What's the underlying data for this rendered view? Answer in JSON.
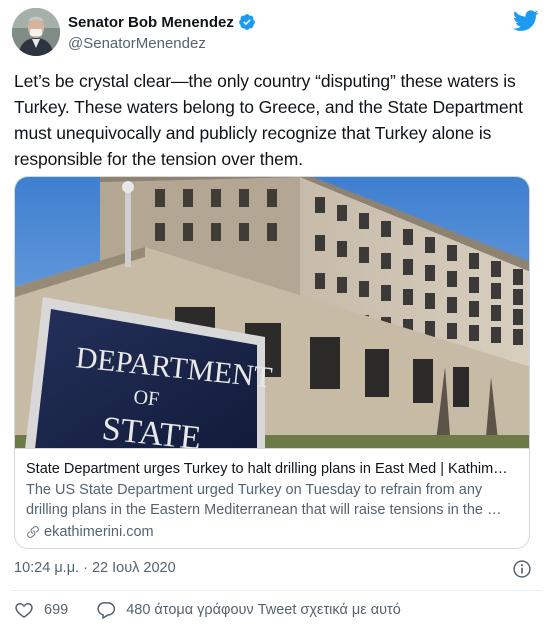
{
  "author": {
    "display_name": "Senator Bob Menendez",
    "handle": "@SenatorMenendez",
    "verified": true
  },
  "tweet": {
    "text": "Let’s be crystal clear—the only country “disputing” these waters is Turkey. These waters belong to Greece, and the State Department must unequivocally and publicly recognize that Turkey alone is responsible for the tension over them."
  },
  "card": {
    "sign_line1": "DEPARTMENT",
    "sign_line2": "OF",
    "sign_line3": "STATE",
    "title": "State Department urges Turkey to halt drilling plans in East Med | Kathim…",
    "description": "The US State Department urged Turkey on Tuesday to refrain from any drilling plans in the Eastern Mediterranean that will raise tensions in the …",
    "domain": "ekathimerini.com"
  },
  "meta": {
    "timestamp": "10:24 μ.μ. · 22 Ιουλ 2020"
  },
  "actions": {
    "like_count": "699",
    "reply_text": "480 άτομα γράφουν Tweet σχετικά με αυτό"
  },
  "colors": {
    "verified_blue": "#1d9bf0",
    "twitter_blue": "#1d9bf0",
    "muted_text": "#536471"
  },
  "icons": {
    "verified": "verified-badge-icon",
    "logo": "twitter-bird-icon",
    "info": "info-icon",
    "like": "heart-icon",
    "reply": "reply-bubble-icon",
    "link": "link-icon"
  }
}
